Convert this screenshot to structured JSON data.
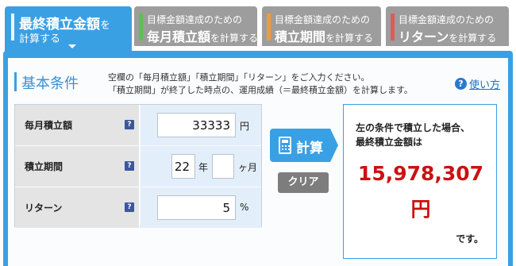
{
  "tabs": [
    {
      "line1": "最終積立金額",
      "line1_suffix": "を",
      "line2": "計算する",
      "active": true
    },
    {
      "line1": "目標金額達成のための",
      "emph": "毎月積立額",
      "suffix": "を計算する",
      "color": "#5fbf4f",
      "active": false
    },
    {
      "line1": "目標金額達成のための",
      "emph": "積立期間",
      "suffix": "を計算する",
      "color": "#f09a3a",
      "active": false
    },
    {
      "line1": "目標金額達成のための",
      "emph": "リターン",
      "suffix": "を計算する",
      "color": "#e05a5a",
      "active": false
    }
  ],
  "section": {
    "title": "基本条件",
    "desc_line1": "空欄の「毎月積立額」「積立期間」「リターン」をご入力ください。",
    "desc_line2": "「積立期間」が終了した時点の、運用成績（＝最終積立金額）を計算します。",
    "help_label": "使い方"
  },
  "form": {
    "monthly": {
      "label": "毎月積立額",
      "value": "33333",
      "unit": "円"
    },
    "period": {
      "label": "積立期間",
      "years_value": "22",
      "years_unit": "年",
      "months_value": "",
      "months_unit": "ヶ月"
    },
    "return": {
      "label": "リターン",
      "value": "5",
      "unit": "%"
    }
  },
  "buttons": {
    "calc": "計算",
    "clear": "クリア"
  },
  "result": {
    "line1": "左の条件で積立した場合、",
    "line2": "最終積立金額は",
    "amount": "15,978,307",
    "currency": "円",
    "tail": "です。"
  },
  "colors": {
    "accent": "#3aa0e4",
    "result_red": "#cc1111",
    "tab_inactive": "#9d9d9d"
  }
}
